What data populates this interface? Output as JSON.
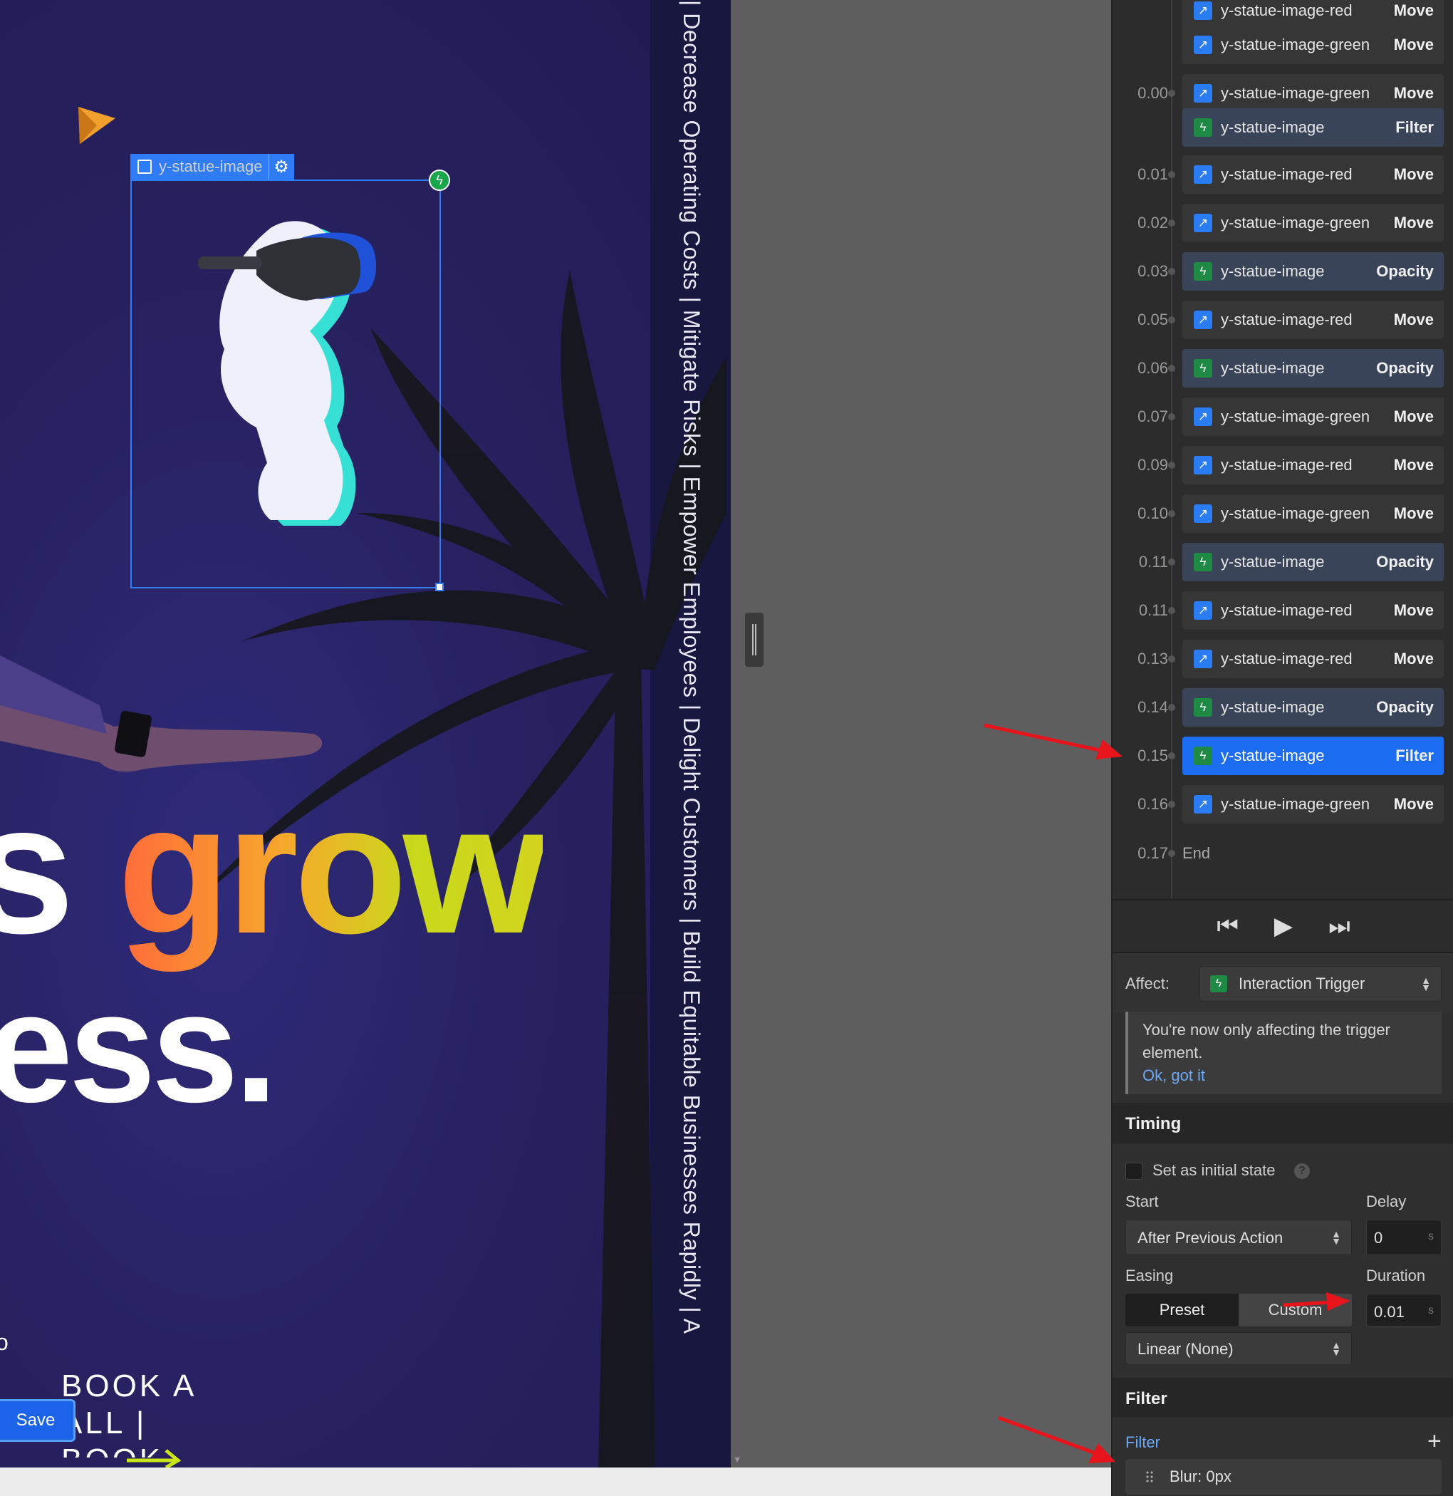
{
  "canvas": {
    "selection_label": "y-statue-image",
    "vertical_marquee": "| Decrease Operating Costs | Mitigate Risks | Empower Employees | Delight Customers | Build Equitable Businesses Rapidly | A",
    "headline_prefix": "s ",
    "headline_highlight": "grow",
    "headline_line2": "ess.",
    "fragment_text": "o",
    "book_line1": "BOOK A",
    "book_line2": "ALL |",
    "book_line3": "BOOK",
    "save_label": "Save"
  },
  "timeline": {
    "rows": [
      {
        "time": "",
        "icon": "move",
        "name": "y-statue-image-red",
        "action": "Move",
        "style": "move"
      },
      {
        "time": "",
        "icon": "move",
        "name": "y-statue-image-green",
        "action": "Move",
        "style": "move"
      },
      {
        "time": "0.00",
        "icon": "move",
        "name": "y-statue-image-green",
        "action": "Move",
        "style": "move"
      },
      {
        "time": "",
        "icon": "trigger",
        "name": "y-statue-image",
        "action": "Filter",
        "style": "trig"
      },
      {
        "time": "0.01",
        "icon": "move",
        "name": "y-statue-image-red",
        "action": "Move",
        "style": "move"
      },
      {
        "time": "0.02",
        "icon": "move",
        "name": "y-statue-image-green",
        "action": "Move",
        "style": "move"
      },
      {
        "time": "0.03",
        "icon": "trigger",
        "name": "y-statue-image",
        "action": "Opacity",
        "style": "trig"
      },
      {
        "time": "0.05",
        "icon": "move",
        "name": "y-statue-image-red",
        "action": "Move",
        "style": "move"
      },
      {
        "time": "0.06",
        "icon": "trigger",
        "name": "y-statue-image",
        "action": "Opacity",
        "style": "trig"
      },
      {
        "time": "0.07",
        "icon": "move",
        "name": "y-statue-image-green",
        "action": "Move",
        "style": "move"
      },
      {
        "time": "0.09",
        "icon": "move",
        "name": "y-statue-image-red",
        "action": "Move",
        "style": "move"
      },
      {
        "time": "0.10",
        "icon": "move",
        "name": "y-statue-image-green",
        "action": "Move",
        "style": "move"
      },
      {
        "time": "0.11",
        "icon": "trigger",
        "name": "y-statue-image",
        "action": "Opacity",
        "style": "trig"
      },
      {
        "time": "0.11",
        "icon": "move",
        "name": "y-statue-image-red",
        "action": "Move",
        "style": "move"
      },
      {
        "time": "0.13",
        "icon": "move",
        "name": "y-statue-image-red",
        "action": "Move",
        "style": "move"
      },
      {
        "time": "0.14",
        "icon": "trigger",
        "name": "y-statue-image",
        "action": "Opacity",
        "style": "trig"
      },
      {
        "time": "0.15",
        "icon": "trigger",
        "name": "y-statue-image",
        "action": "Filter",
        "style": "selected"
      },
      {
        "time": "0.16",
        "icon": "move",
        "name": "y-statue-image-green",
        "action": "Move",
        "style": "move"
      }
    ],
    "end_time": "0.17",
    "end_label": "End"
  },
  "affect": {
    "label": "Affect:",
    "value": "Interaction Trigger",
    "notice": "You're now only affecting the trigger element.",
    "notice_link": "Ok, got it"
  },
  "timing": {
    "title": "Timing",
    "initial_state_label": "Set as initial state",
    "start_label": "Start",
    "start_value": "After Previous Action",
    "delay_label": "Delay",
    "delay_value": "0",
    "unit": "s",
    "easing_label": "Easing",
    "preset_label": "Preset",
    "custom_label": "Custom",
    "duration_label": "Duration",
    "duration_value": "0.01",
    "easing_value": "Linear (None)"
  },
  "filter": {
    "title": "Filter",
    "link_label": "Filter",
    "item": "Blur: 0px"
  },
  "colors": {
    "accent": "#1d6df2",
    "trigger_green": "#1e8a44",
    "annotation_red": "#e8141b"
  }
}
